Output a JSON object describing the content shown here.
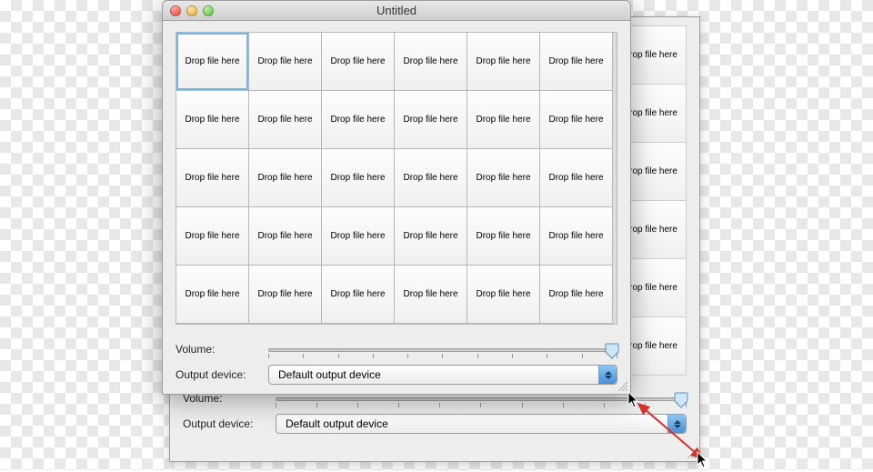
{
  "window": {
    "title": "Untitled"
  },
  "grid": {
    "cell_label": "Drop file here",
    "rows": 5,
    "cols": 6
  },
  "back_grid": {
    "cell_label": "Drop file here",
    "rows": 6,
    "cols": 7
  },
  "controls": {
    "volume_label": "Volume:",
    "output_label": "Output device:",
    "output_selected": "Default output device"
  },
  "colors": {
    "macos_blue": "#4a8fd8",
    "slider_thumb": "#6fb3e8",
    "annotation_red": "#d6302b"
  }
}
